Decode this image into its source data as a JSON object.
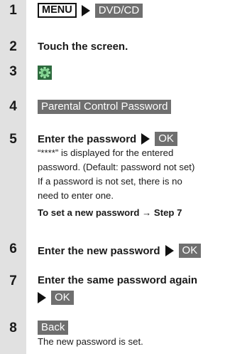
{
  "steps": [
    {
      "number": "1",
      "menu_button": "MENU",
      "target_button": "DVD/CD"
    },
    {
      "number": "2",
      "text": "Touch the screen."
    },
    {
      "number": "3",
      "icon": "settings-gear-icon"
    },
    {
      "number": "4",
      "button": "Parental Control Password"
    },
    {
      "number": "5",
      "text": "Enter the password",
      "button": "OK",
      "note_lines": [
        "“****” is displayed for the entered",
        "password. (Default: password not set)",
        "If a password is not set, there is no",
        "need to enter one."
      ],
      "tip": "To set a new password → Step 7"
    },
    {
      "number": "6",
      "text": "Enter the new password",
      "button": "OK"
    },
    {
      "number": "7",
      "text": "Enter the same password again",
      "button": "OK"
    },
    {
      "number": "8",
      "button": "Back",
      "note": "The new password is set."
    }
  ],
  "colors": {
    "gutter": "#e1e1e1",
    "button": "#6f6f6f",
    "gear": "#3f8f5a"
  }
}
